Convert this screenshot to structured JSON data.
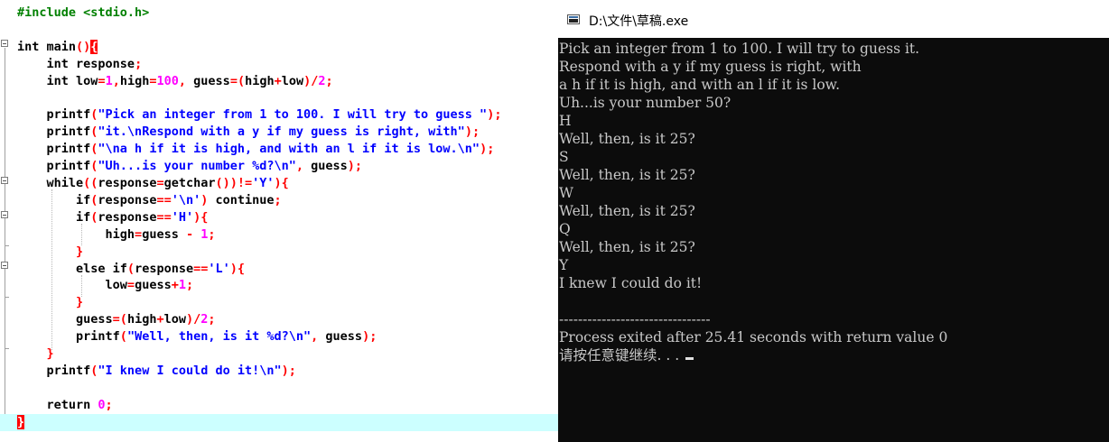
{
  "editor": {
    "lines": [
      [
        {
          "t": "#include <stdio.h>",
          "c": "pp"
        }
      ],
      [],
      [
        {
          "t": "int",
          "c": "kw"
        },
        {
          "t": " main",
          "c": "fn"
        },
        {
          "t": "()",
          "c": "op"
        },
        {
          "t": "{",
          "c": "bracehl"
        }
      ],
      [
        {
          "t": "    int",
          "c": "kw"
        },
        {
          "t": " response",
          "c": "fn"
        },
        {
          "t": ";",
          "c": "op"
        }
      ],
      [
        {
          "t": "    int",
          "c": "kw"
        },
        {
          "t": " low",
          "c": "fn"
        },
        {
          "t": "=",
          "c": "op"
        },
        {
          "t": "1",
          "c": "num"
        },
        {
          "t": ",",
          "c": "op"
        },
        {
          "t": "high",
          "c": "fn"
        },
        {
          "t": "=",
          "c": "op"
        },
        {
          "t": "100",
          "c": "num"
        },
        {
          "t": ",",
          "c": "op"
        },
        {
          "t": " guess",
          "c": "fn"
        },
        {
          "t": "=(",
          "c": "op"
        },
        {
          "t": "high",
          "c": "fn"
        },
        {
          "t": "+",
          "c": "op"
        },
        {
          "t": "low",
          "c": "fn"
        },
        {
          "t": ")/",
          "c": "op"
        },
        {
          "t": "2",
          "c": "num"
        },
        {
          "t": ";",
          "c": "op"
        }
      ],
      [],
      [
        {
          "t": "    printf",
          "c": "fn"
        },
        {
          "t": "(",
          "c": "op"
        },
        {
          "t": "\"Pick an integer from 1 to 100. I will try to guess \"",
          "c": "str"
        },
        {
          "t": ");",
          "c": "op"
        }
      ],
      [
        {
          "t": "    printf",
          "c": "fn"
        },
        {
          "t": "(",
          "c": "op"
        },
        {
          "t": "\"it.\\nRespond with a y if my guess is right, with\"",
          "c": "str"
        },
        {
          "t": ");",
          "c": "op"
        }
      ],
      [
        {
          "t": "    printf",
          "c": "fn"
        },
        {
          "t": "(",
          "c": "op"
        },
        {
          "t": "\"\\na h if it is high, and with an l if it is low.\\n\"",
          "c": "str"
        },
        {
          "t": ");",
          "c": "op"
        }
      ],
      [
        {
          "t": "    printf",
          "c": "fn"
        },
        {
          "t": "(",
          "c": "op"
        },
        {
          "t": "\"Uh...is your number %d?\\n\"",
          "c": "str"
        },
        {
          "t": ",",
          "c": "op"
        },
        {
          "t": " guess",
          "c": "fn"
        },
        {
          "t": ");",
          "c": "op"
        }
      ],
      [
        {
          "t": "    while",
          "c": "kw"
        },
        {
          "t": "((",
          "c": "op"
        },
        {
          "t": "response",
          "c": "fn"
        },
        {
          "t": "=",
          "c": "op"
        },
        {
          "t": "getchar",
          "c": "fn"
        },
        {
          "t": "())!=",
          "c": "op"
        },
        {
          "t": "'Y'",
          "c": "chr"
        },
        {
          "t": "){",
          "c": "op"
        }
      ],
      [
        {
          "t": "        if",
          "c": "kw"
        },
        {
          "t": "(",
          "c": "op"
        },
        {
          "t": "response",
          "c": "fn"
        },
        {
          "t": "==",
          "c": "op"
        },
        {
          "t": "'\\n'",
          "c": "chr"
        },
        {
          "t": ")",
          "c": "op"
        },
        {
          "t": " continue",
          "c": "kw"
        },
        {
          "t": ";",
          "c": "op"
        }
      ],
      [
        {
          "t": "        if",
          "c": "kw"
        },
        {
          "t": "(",
          "c": "op"
        },
        {
          "t": "response",
          "c": "fn"
        },
        {
          "t": "==",
          "c": "op"
        },
        {
          "t": "'H'",
          "c": "chr"
        },
        {
          "t": "){",
          "c": "op"
        }
      ],
      [
        {
          "t": "            high",
          "c": "fn"
        },
        {
          "t": "=",
          "c": "op"
        },
        {
          "t": "guess ",
          "c": "fn"
        },
        {
          "t": "-",
          "c": "op"
        },
        {
          "t": " 1",
          "c": "num"
        },
        {
          "t": ";",
          "c": "op"
        }
      ],
      [
        {
          "t": "        }",
          "c": "op"
        }
      ],
      [
        {
          "t": "        else if",
          "c": "kw"
        },
        {
          "t": "(",
          "c": "op"
        },
        {
          "t": "response",
          "c": "fn"
        },
        {
          "t": "==",
          "c": "op"
        },
        {
          "t": "'L'",
          "c": "chr"
        },
        {
          "t": "){",
          "c": "op"
        }
      ],
      [
        {
          "t": "            low",
          "c": "fn"
        },
        {
          "t": "=",
          "c": "op"
        },
        {
          "t": "guess",
          "c": "fn"
        },
        {
          "t": "+",
          "c": "op"
        },
        {
          "t": "1",
          "c": "num"
        },
        {
          "t": ";",
          "c": "op"
        }
      ],
      [
        {
          "t": "        }",
          "c": "op"
        }
      ],
      [
        {
          "t": "        guess",
          "c": "fn"
        },
        {
          "t": "=(",
          "c": "op"
        },
        {
          "t": "high",
          "c": "fn"
        },
        {
          "t": "+",
          "c": "op"
        },
        {
          "t": "low",
          "c": "fn"
        },
        {
          "t": ")/",
          "c": "op"
        },
        {
          "t": "2",
          "c": "num"
        },
        {
          "t": ";",
          "c": "op"
        }
      ],
      [
        {
          "t": "        printf",
          "c": "fn"
        },
        {
          "t": "(",
          "c": "op"
        },
        {
          "t": "\"Well, then, is it %d?\\n\"",
          "c": "str"
        },
        {
          "t": ",",
          "c": "op"
        },
        {
          "t": " guess",
          "c": "fn"
        },
        {
          "t": ");",
          "c": "op"
        }
      ],
      [
        {
          "t": "    }",
          "c": "op"
        }
      ],
      [
        {
          "t": "    printf",
          "c": "fn"
        },
        {
          "t": "(",
          "c": "op"
        },
        {
          "t": "\"I knew I could do it!\\n\"",
          "c": "str"
        },
        {
          "t": ");",
          "c": "op"
        }
      ],
      [],
      [
        {
          "t": "    return",
          "c": "kw"
        },
        {
          "t": " 0",
          "c": "num"
        },
        {
          "t": ";",
          "c": "op"
        }
      ],
      [
        {
          "t": "}",
          "c": "bracehl"
        }
      ]
    ],
    "current_line": 24
  },
  "console": {
    "title": "D:\\文件\\草稿.exe",
    "lines": [
      "Pick an integer from 1 to 100. I will try to guess it.",
      "Respond with a y if my guess is right, with",
      "a h if it is high, and with an l if it is low.",
      "Uh...is your number 50?",
      "H",
      "Well, then, is it 25?",
      "S",
      "Well, then, is it 25?",
      "W",
      "Well, then, is it 25?",
      "Q",
      "Well, then, is it 25?",
      "Y",
      "I knew I could do it!",
      "",
      "--------------------------------",
      "Process exited after 25.41 seconds with return value 0",
      "请按任意键继续. . . "
    ]
  },
  "colors": {
    "editor_bg": "#ffffff",
    "current_line_bg": "#ccffff",
    "console_bg": "#0c0c0c",
    "console_fg": "#c8c8c8"
  }
}
